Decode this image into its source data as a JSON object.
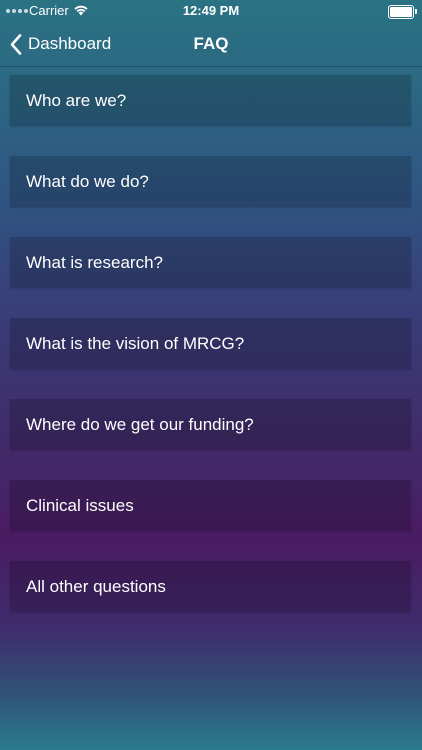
{
  "status_bar": {
    "carrier": "Carrier",
    "time": "12:49 PM",
    "wifi_icon": "wifi-icon",
    "battery_icon": "battery-icon"
  },
  "nav": {
    "back_label": "Dashboard",
    "back_icon": "chevron-left-icon",
    "title": "FAQ"
  },
  "faq": {
    "items": [
      {
        "label": "Who are we?"
      },
      {
        "label": "What do we do?"
      },
      {
        "label": "What is research?"
      },
      {
        "label": "What is the vision of MRCG?"
      },
      {
        "label": "Where do we get our funding?"
      },
      {
        "label": "Clinical issues"
      },
      {
        "label": "All other questions"
      }
    ]
  },
  "colors": {
    "gradient_top": "#2a7383",
    "gradient_mid": "#393d78",
    "gradient_purple": "#4b1b63",
    "gradient_bottom": "#2b7b8e",
    "text": "#ffffff"
  }
}
